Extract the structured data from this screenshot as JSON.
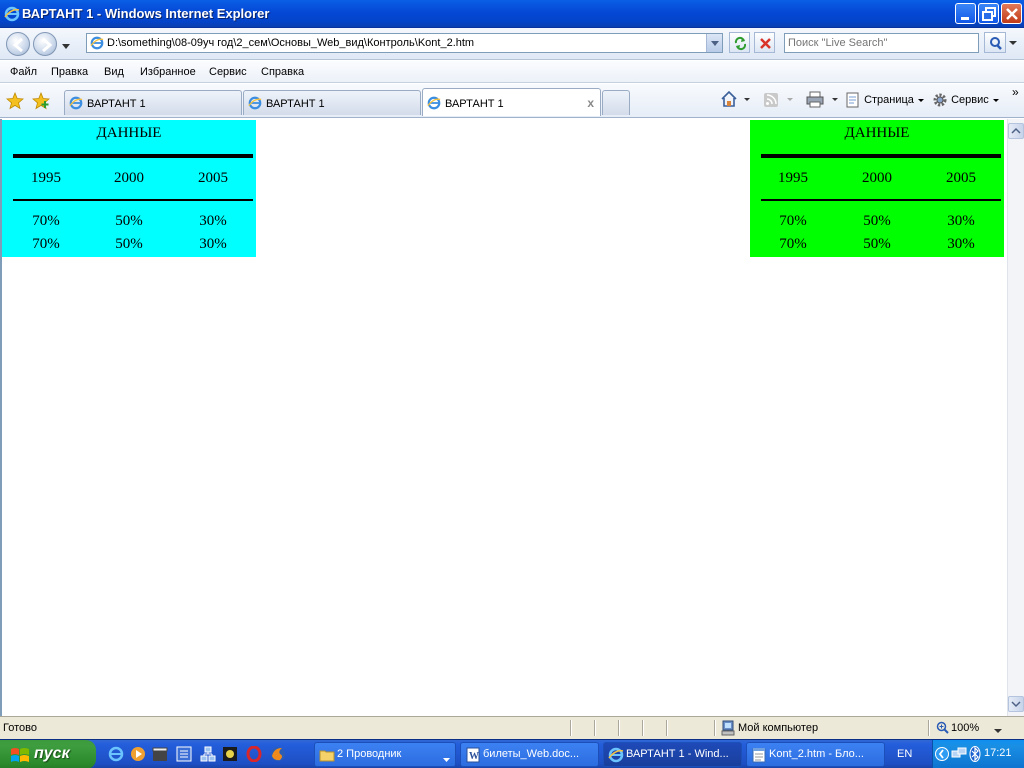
{
  "window": {
    "title": "ВАРТАНТ 1 - Windows Internet Explorer"
  },
  "address_bar": {
    "url": "D:\\something\\08-09уч год\\2_сем\\Основы_Web_вид\\Контроль\\Kont_2.htm",
    "search_placeholder": "Поиск \"Live Search\""
  },
  "menu": {
    "items": [
      "Файл",
      "Правка",
      "Вид",
      "Избранное",
      "Сервис",
      "Справка"
    ]
  },
  "tabs": [
    {
      "label": "ВАРТАНТ 1",
      "active": false
    },
    {
      "label": "ВАРТАНТ 1",
      "active": false
    },
    {
      "label": "ВАРТАНТ 1",
      "active": true
    }
  ],
  "command_bar": {
    "page_label": "Страница",
    "tools_label": "Сервис",
    "chevron": "»"
  },
  "page": {
    "tables": [
      {
        "background": "#00ffff",
        "title": "ДАННЫЕ",
        "years": [
          "1995",
          "2000",
          "2005"
        ],
        "rows": [
          [
            "70%",
            "50%",
            "30%"
          ],
          [
            "70%",
            "50%",
            "30%"
          ]
        ]
      },
      {
        "background": "#00ff00",
        "title": "ДАННЫЕ",
        "years": [
          "1995",
          "2000",
          "2005"
        ],
        "rows": [
          [
            "70%",
            "50%",
            "30%"
          ],
          [
            "70%",
            "50%",
            "30%"
          ]
        ]
      }
    ]
  },
  "status_bar": {
    "status": "Готово",
    "zone": "Мой компьютер",
    "zoom": "100%"
  },
  "taskbar": {
    "start_label": "пуск",
    "tasks": [
      {
        "label": "2 Проводник",
        "active": false
      },
      {
        "label": "билеты_Web.doc...",
        "active": false
      },
      {
        "label": "ВАРТАНТ 1 - Wind...",
        "active": true
      },
      {
        "label": "Kont_2.htm - Бло...",
        "active": false
      }
    ],
    "language": "EN",
    "clock": "17:21"
  }
}
